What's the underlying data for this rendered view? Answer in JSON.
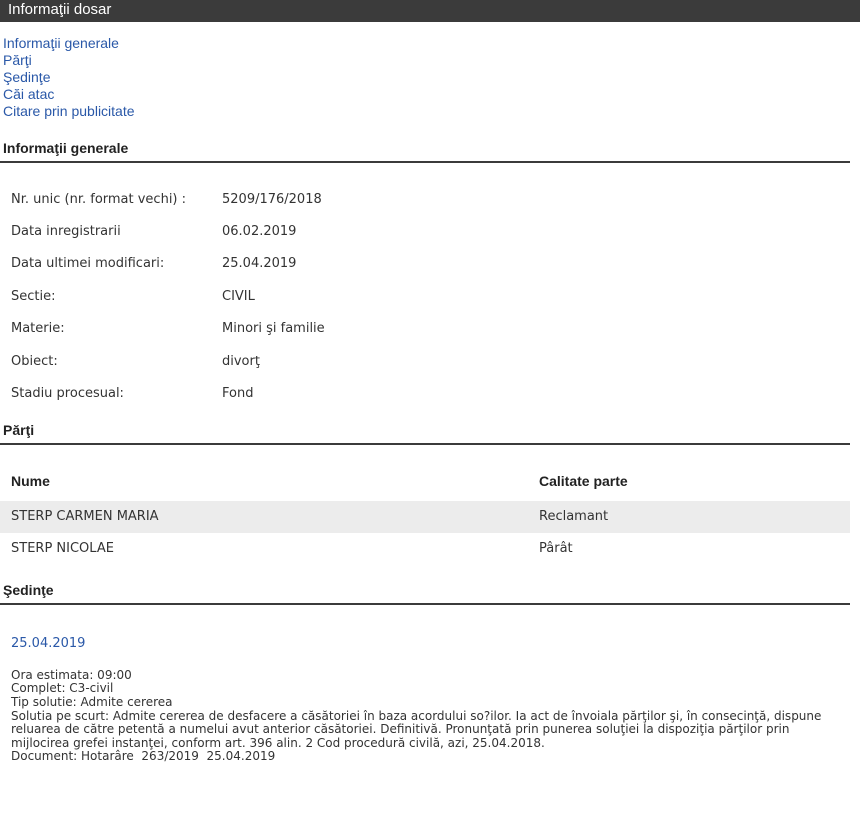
{
  "titlebar": {
    "title": "Informaţii dosar"
  },
  "nav": [
    "Informaţii generale",
    "Părţi",
    "Şedinţe",
    "Căi atac",
    "Citare prin publicitate"
  ],
  "info": {
    "heading": "Informaţii generale",
    "rows": [
      {
        "label": "Nr. unic (nr. format vechi) :",
        "value": "5209/176/2018"
      },
      {
        "label": "Data inregistrarii",
        "value": "06.02.2019"
      },
      {
        "label": "Data ultimei modificari:",
        "value": "25.04.2019"
      },
      {
        "label": "Sectie:",
        "value": "CIVIL"
      },
      {
        "label": "Materie:",
        "value": "Minori şi familie"
      },
      {
        "label": "Obiect:",
        "value": "divorţ"
      },
      {
        "label": "Stadiu procesual:",
        "value": "Fond"
      }
    ]
  },
  "parti": {
    "heading": "Părţi",
    "columns": [
      "Nume",
      "Calitate parte"
    ],
    "rows": [
      [
        "STERP CARMEN MARIA",
        "Reclamant"
      ],
      [
        "STERP NICOLAE",
        "Pârât"
      ]
    ]
  },
  "sedinte": {
    "heading": "Şedinţe",
    "date": "25.04.2019",
    "ora": "Ora estimata: 09:00",
    "complet": "Complet: C3-civil",
    "tip_solutie": "Tip solutie: Admite cererea",
    "solutie": "Solutia pe scurt: Admite cererea de desfacere a căsătoriei în baza acordului so?ilor. Ia act de învoiala părţilor şi, în consecinţă, dispune reluarea de către petentă a numelui avut anterior căsătoriei. Definitivă. Pronunţată prin punerea soluţiei la dispoziţia părţilor prin mijlocirea grefei instanţei, conform art. 396 alin. 2 Cod procedură civilă, azi, 25.04.2018.",
    "document": "Document: Hotarâre  263/2019  25.04.2019"
  }
}
